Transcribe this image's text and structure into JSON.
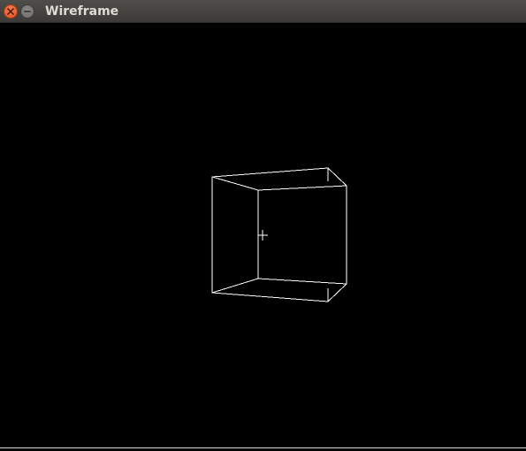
{
  "window": {
    "title": "Wireframe",
    "close_icon": "close-icon",
    "minimize_icon": "minimize-icon"
  },
  "canvas": {
    "background": "#000000",
    "wire_color": "#ffffff",
    "cursor_icon": "crosshair-icon"
  }
}
